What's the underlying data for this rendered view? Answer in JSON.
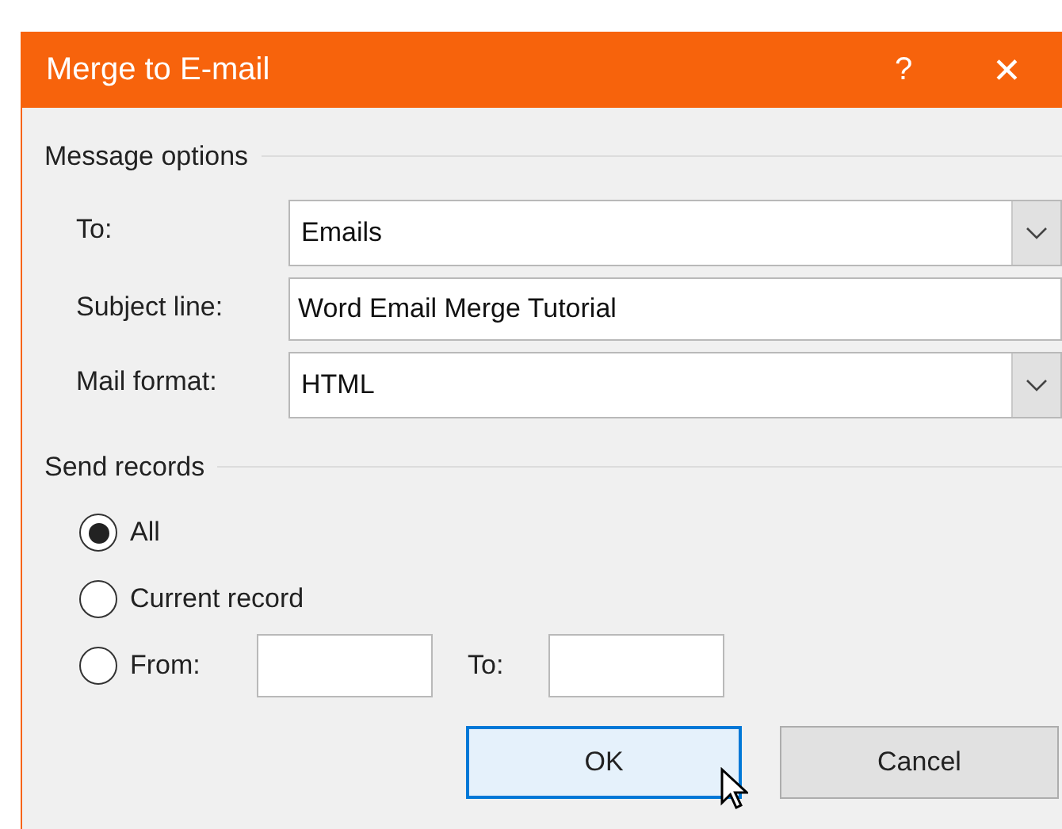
{
  "window": {
    "title": "Merge to E-mail",
    "help": "?",
    "close": "✕"
  },
  "message_options": {
    "heading": "Message options",
    "fields": [
      {
        "kind": "dropdown",
        "label": "To:",
        "value": "Emails"
      },
      {
        "kind": "text",
        "label": "Subject line:",
        "value": "Word Email Merge Tutorial"
      },
      {
        "kind": "dropdown",
        "label": "Mail format:",
        "value": "HTML"
      }
    ]
  },
  "send_records": {
    "heading": "Send records",
    "options": [
      {
        "kind": "plain",
        "label": "All",
        "selected": true
      },
      {
        "kind": "plain",
        "label": "Current record",
        "selected": false
      },
      {
        "kind": "range",
        "label": "From:",
        "selected": false,
        "to_label": "To:"
      }
    ]
  },
  "buttons": [
    {
      "label": "OK",
      "focused": true
    },
    {
      "label": "Cancel",
      "focused": false
    }
  ]
}
